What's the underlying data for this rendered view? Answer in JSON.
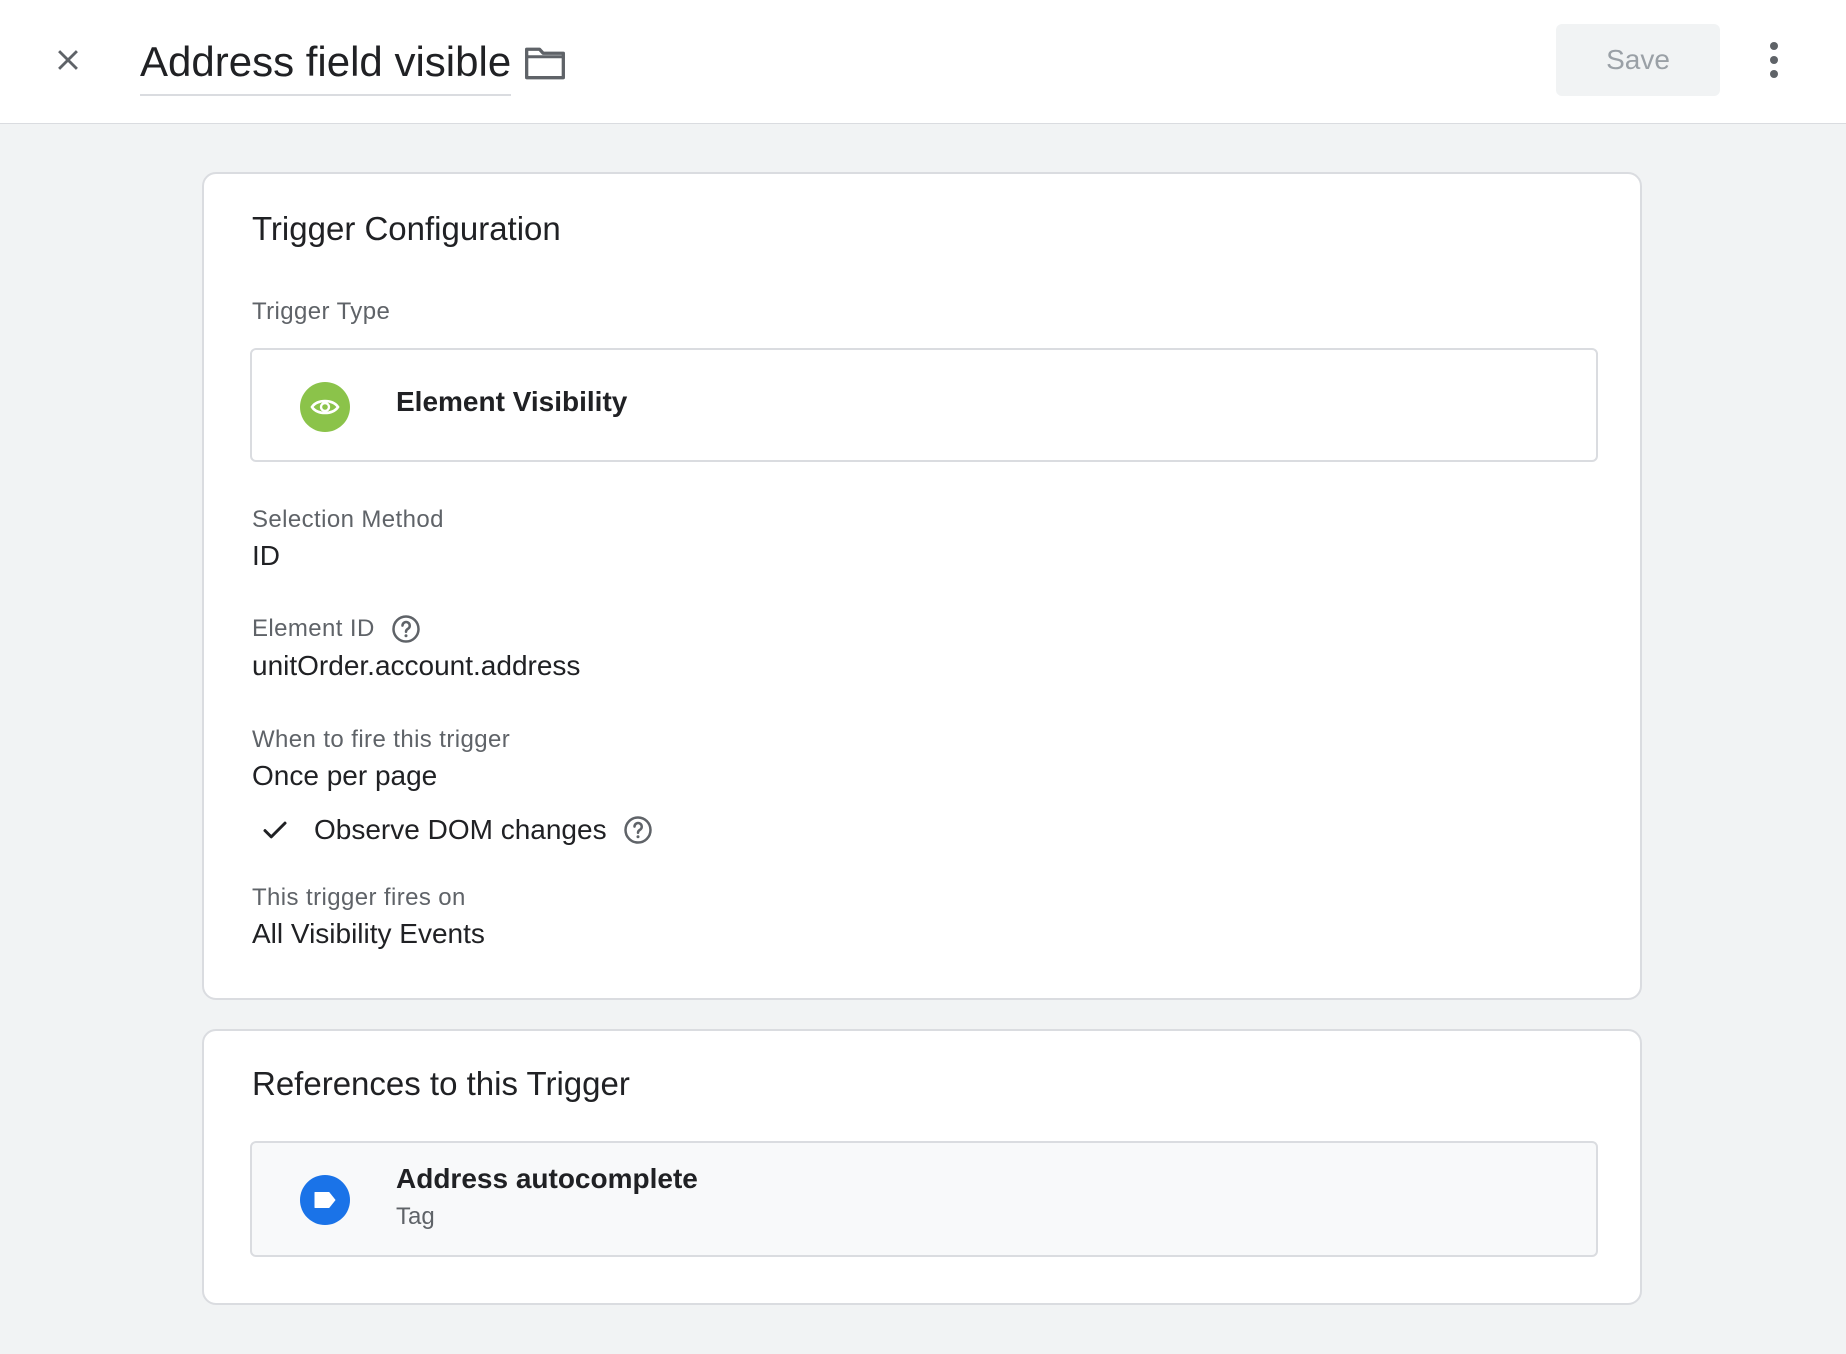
{
  "header": {
    "title": "Address field visible",
    "save_label": "Save"
  },
  "icons": {
    "close": "close-icon",
    "folder": "folder-icon",
    "more": "more-vert-icon",
    "trigger_type": "eye-icon",
    "help": "help-icon",
    "check": "check-icon",
    "tag": "tag-icon"
  },
  "colors": {
    "trigger_type_icon_bg": "#8bc34a",
    "tag_icon_bg": "#1a73e8",
    "save_disabled_text": "#9aa0a6"
  },
  "trigger_config": {
    "title": "Trigger Configuration",
    "trigger_type_label": "Trigger Type",
    "trigger_type_value": "Element Visibility",
    "selection_method_label": "Selection Method",
    "selection_method_value": "ID",
    "element_id_label": "Element ID",
    "element_id_value": "unitOrder.account.address",
    "when_to_fire_label": "When to fire this trigger",
    "when_to_fire_value": "Once per page",
    "observe_dom_label": "Observe DOM changes",
    "fires_on_label": "This trigger fires on",
    "fires_on_value": "All Visibility Events"
  },
  "references": {
    "title": "References to this Trigger",
    "items": [
      {
        "name": "Address autocomplete",
        "kind": "Tag"
      }
    ]
  }
}
